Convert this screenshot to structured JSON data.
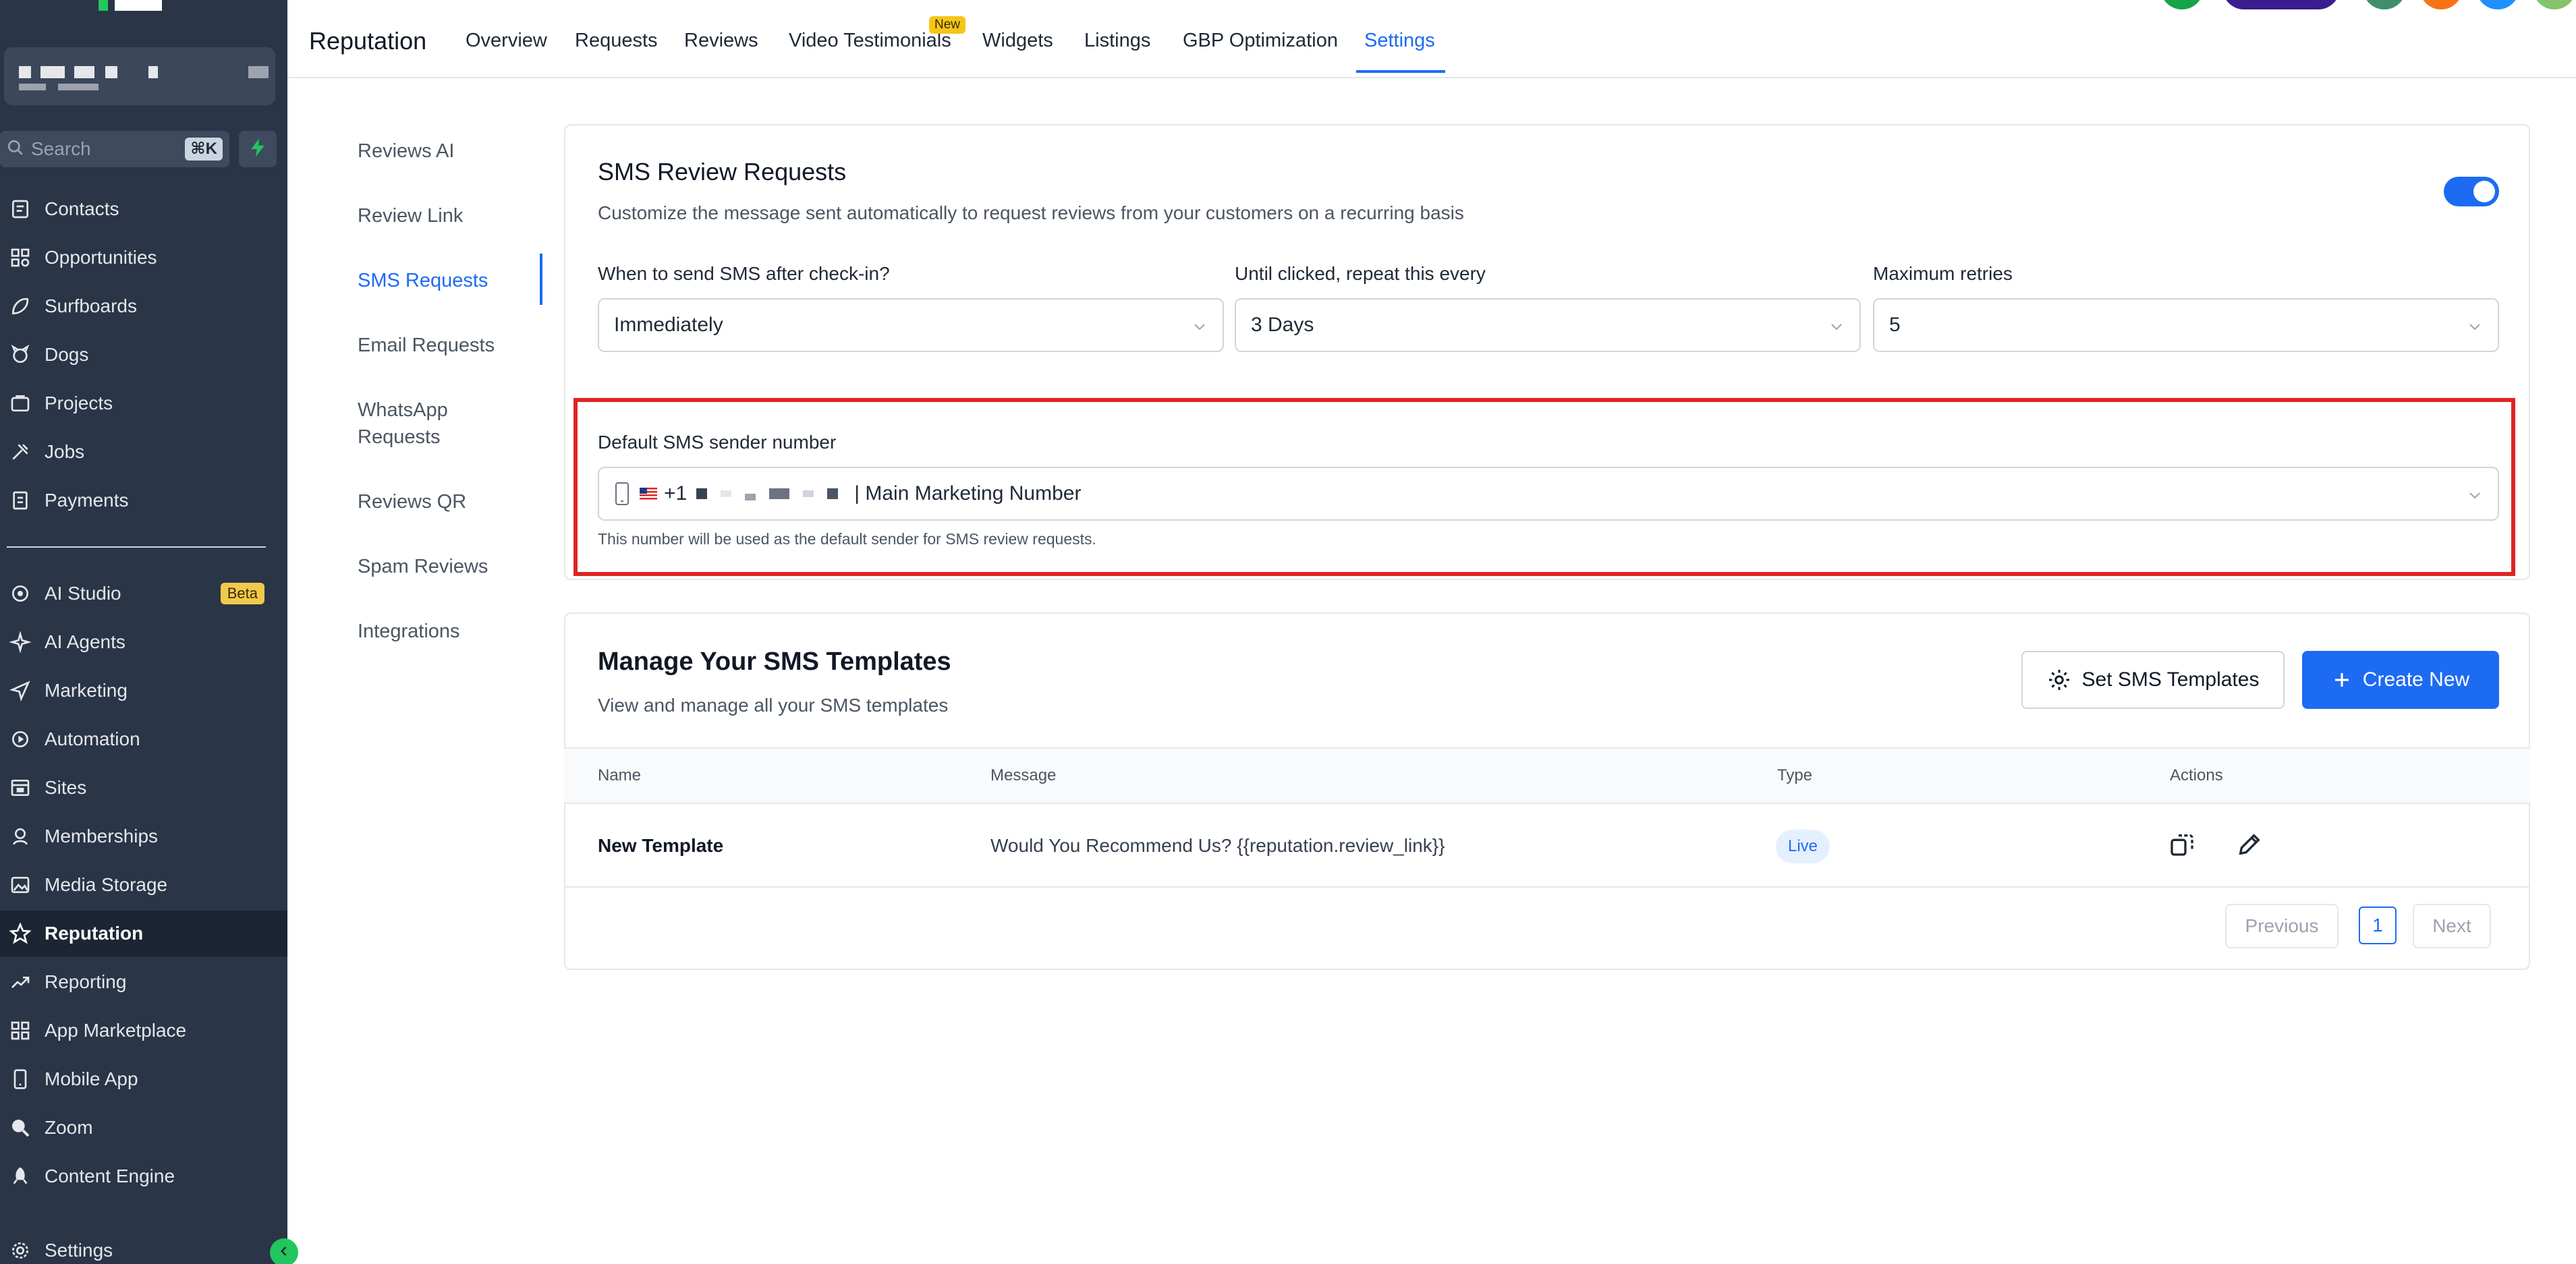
{
  "sidebar": {
    "search": {
      "placeholder": "Search",
      "shortcut": "⌘K"
    },
    "items": [
      {
        "label": "Contacts",
        "icon": "contacts-icon"
      },
      {
        "label": "Opportunities",
        "icon": "opportunities-icon"
      },
      {
        "label": "Surfboards",
        "icon": "surfboard-icon"
      },
      {
        "label": "Dogs",
        "icon": "dog-icon"
      },
      {
        "label": "Projects",
        "icon": "projects-icon"
      },
      {
        "label": "Jobs",
        "icon": "jobs-icon"
      },
      {
        "label": "Payments",
        "icon": "payments-icon"
      }
    ],
    "items2": [
      {
        "label": "AI Studio",
        "icon": "ai-studio-icon",
        "badge": "Beta"
      },
      {
        "label": "AI Agents",
        "icon": "ai-agents-icon"
      },
      {
        "label": "Marketing",
        "icon": "send-icon"
      },
      {
        "label": "Automation",
        "icon": "automation-icon"
      },
      {
        "label": "Sites",
        "icon": "sites-icon"
      },
      {
        "label": "Memberships",
        "icon": "memberships-icon"
      },
      {
        "label": "Media Storage",
        "icon": "image-icon"
      },
      {
        "label": "Reputation",
        "icon": "star-icon",
        "active": true
      },
      {
        "label": "Reporting",
        "icon": "trend-icon"
      },
      {
        "label": "App Marketplace",
        "icon": "grid-icon"
      },
      {
        "label": "Mobile App",
        "icon": "mobile-icon"
      },
      {
        "label": "Zoom",
        "icon": "zoom-icon"
      },
      {
        "label": "Content Engine",
        "icon": "rocket-icon"
      },
      {
        "label": "Settings",
        "icon": "gear-icon"
      }
    ]
  },
  "header": {
    "title": "Reputation",
    "tabs": [
      "Overview",
      "Requests",
      "Reviews",
      "Video Testimonials",
      "Widgets",
      "Listings",
      "GBP Optimization",
      "Settings"
    ],
    "active_tab": "Settings",
    "new_badge": "New"
  },
  "subnav": {
    "items": [
      "Reviews AI",
      "Review Link",
      "SMS Requests",
      "Email Requests",
      "WhatsApp Requests",
      "Reviews QR",
      "Spam Reviews",
      "Integrations"
    ],
    "active": "SMS Requests"
  },
  "sms_requests": {
    "title": "SMS Review Requests",
    "description": "Customize the message sent automatically to request reviews from your customers on a recurring basis",
    "enabled": true,
    "when_label": "When to send SMS after check-in?",
    "when_value": "Immediately",
    "repeat_label": "Until clicked, repeat this every",
    "repeat_value": "3 Days",
    "retries_label": "Maximum retries",
    "retries_value": "5",
    "sender_label": "Default SMS sender number",
    "sender_prefix": "+1",
    "sender_suffix": "| Main Marketing Number",
    "sender_help": "This number will be used as the default sender for SMS review requests."
  },
  "templates": {
    "title": "Manage Your SMS Templates",
    "description": "View and manage all your SMS templates",
    "set_button": "Set SMS Templates",
    "create_button": "Create New",
    "columns": [
      "Name",
      "Message",
      "Type",
      "Actions"
    ],
    "rows": [
      {
        "name": "New Template",
        "message": "Would You Recommend Us? {{reputation.review_link}}",
        "type": "Live"
      }
    ],
    "pager": {
      "previous": "Previous",
      "page": "1",
      "next": "Next"
    }
  },
  "colors": {
    "accent": "#1d6bf3",
    "sidebar": "#2a3547",
    "highlight": "#e02424"
  }
}
